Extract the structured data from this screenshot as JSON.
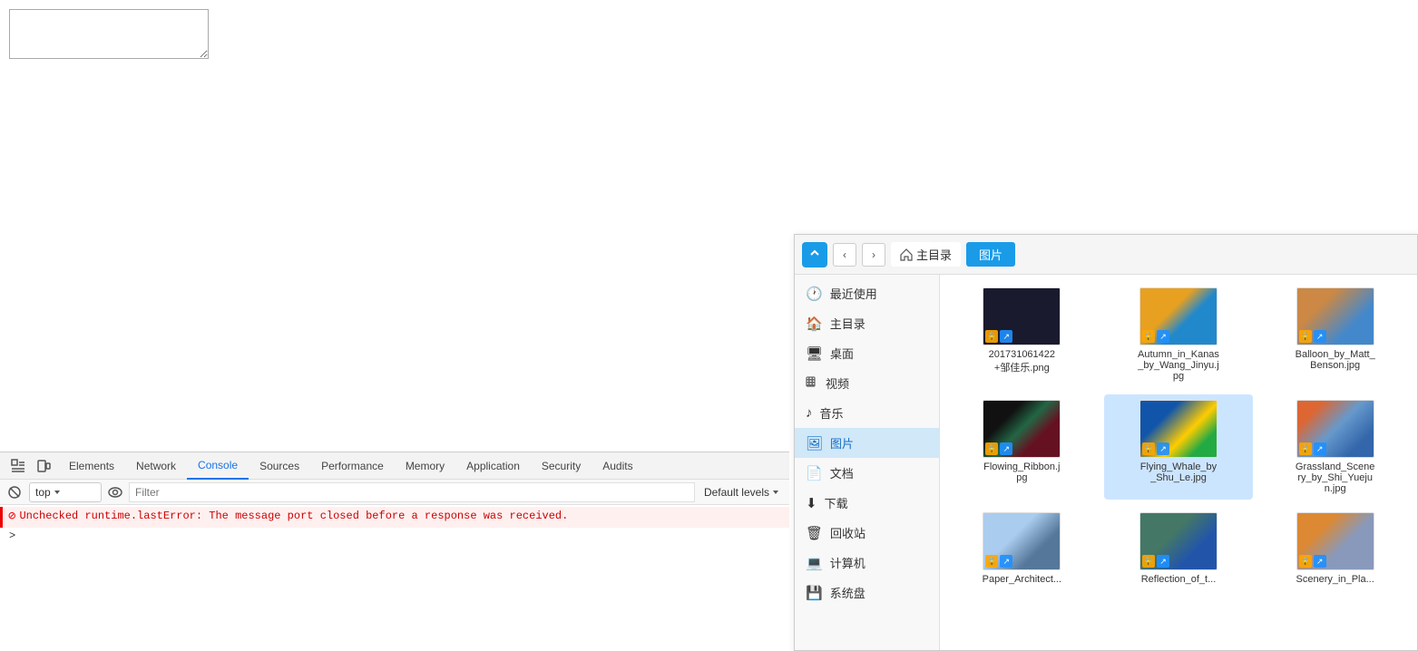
{
  "page": {
    "textarea_placeholder": ""
  },
  "devtools": {
    "tabs": [
      {
        "id": "elements",
        "label": "Elements",
        "active": false
      },
      {
        "id": "network",
        "label": "Network",
        "active": false
      },
      {
        "id": "console",
        "label": "Console",
        "active": true
      },
      {
        "id": "sources",
        "label": "Sources",
        "active": false
      },
      {
        "id": "performance",
        "label": "Performance",
        "active": false
      },
      {
        "id": "memory",
        "label": "Memory",
        "active": false
      },
      {
        "id": "application",
        "label": "Application",
        "active": false
      },
      {
        "id": "security",
        "label": "Security",
        "active": false
      },
      {
        "id": "audits",
        "label": "Audits",
        "active": false
      }
    ],
    "console": {
      "context": "top",
      "filter_placeholder": "Filter",
      "default_levels": "Default levels",
      "error_message": "Unchecked runtime.lastError: The message port closed before a response was received.",
      "caret": ">"
    }
  },
  "file_manager": {
    "toolbar": {
      "home_label": "主目录",
      "pictures_label": "图片"
    },
    "sidebar": [
      {
        "id": "recent",
        "label": "最近使用",
        "icon": "🕐"
      },
      {
        "id": "home",
        "label": "主目录",
        "icon": "🏠"
      },
      {
        "id": "desktop",
        "label": "桌面",
        "icon": "🖥"
      },
      {
        "id": "videos",
        "label": "视频",
        "icon": "⊞"
      },
      {
        "id": "music",
        "label": "音乐",
        "icon": "♪"
      },
      {
        "id": "pictures",
        "label": "图片",
        "icon": "🖼",
        "active": true
      },
      {
        "id": "documents",
        "label": "文档",
        "icon": "📄"
      },
      {
        "id": "downloads",
        "label": "下载",
        "icon": "⬇"
      },
      {
        "id": "trash",
        "label": "回收站",
        "icon": "🗑"
      },
      {
        "id": "computer",
        "label": "计算机",
        "icon": "💻"
      },
      {
        "id": "system",
        "label": "系统盘",
        "icon": "💾"
      }
    ],
    "files": [
      {
        "id": "f1",
        "name": "201731061422+邹佳乐.png",
        "thumb": "dark",
        "lock": true,
        "share": true,
        "selected": false
      },
      {
        "id": "f2",
        "name": "Autumn_in_Kanas_by_Wang_Jinyu.jpg",
        "thumb": "autumn",
        "lock": true,
        "share": true,
        "selected": false
      },
      {
        "id": "f3",
        "name": "Balloon_by_Matt_Benson.jpg",
        "thumb": "balloon",
        "lock": true,
        "share": true,
        "selected": false
      },
      {
        "id": "f4",
        "name": "Flowing_Ribbon.jpg",
        "thumb": "flowing",
        "lock": true,
        "share": true,
        "selected": false
      },
      {
        "id": "f5",
        "name": "Flying_Whale_by_Shu_Le.jpg",
        "thumb": "whale",
        "lock": true,
        "share": true,
        "selected": true
      },
      {
        "id": "f6",
        "name": "Grassland_Scenery_by_Shi_Yuejun.jpg",
        "thumb": "grassland",
        "lock": true,
        "share": true,
        "selected": false
      },
      {
        "id": "f7",
        "name": "Paper_Architect...",
        "thumb": "paper",
        "lock": true,
        "share": true,
        "selected": false
      },
      {
        "id": "f8",
        "name": "Reflection_of_t...",
        "thumb": "reflection",
        "lock": true,
        "share": true,
        "selected": false
      },
      {
        "id": "f9",
        "name": "Scenery_in_Pla...",
        "thumb": "scenery",
        "lock": true,
        "share": true,
        "selected": false
      }
    ]
  }
}
